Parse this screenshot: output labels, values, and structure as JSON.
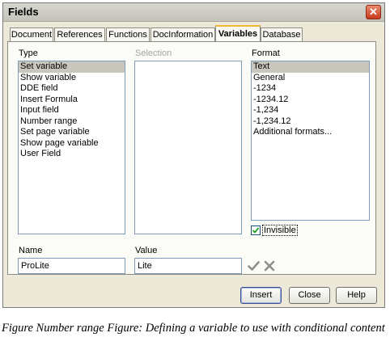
{
  "window": {
    "title": "Fields",
    "close_glyph": "✕"
  },
  "tabs": [
    {
      "label": "Document",
      "active": false
    },
    {
      "label": "References",
      "active": false
    },
    {
      "label": "Functions",
      "active": false
    },
    {
      "label": "DocInformation",
      "active": false
    },
    {
      "label": "Variables",
      "active": true
    },
    {
      "label": "Database",
      "active": false
    }
  ],
  "type": {
    "label": "Type",
    "items": [
      "Set variable",
      "Show variable",
      "DDE field",
      "Insert Formula",
      "Input field",
      "Number range",
      "Set page variable",
      "Show page variable",
      "User Field"
    ],
    "selected": "Set variable"
  },
  "selection": {
    "label": "Selection",
    "items": []
  },
  "format": {
    "label": "Format",
    "items": [
      "Text",
      "General",
      "-1234",
      "-1234.12",
      "-1,234",
      "-1,234.12",
      "Additional formats..."
    ],
    "selected": "Text"
  },
  "invisible": {
    "label": "Invisible",
    "checked": true
  },
  "name": {
    "label": "Name",
    "value": "ProLite"
  },
  "value": {
    "label": "Value",
    "value": "Lite"
  },
  "icons": {
    "apply": "check-icon",
    "delete": "cross-icon"
  },
  "buttons": {
    "insert": "Insert",
    "close": "Close",
    "help": "Help"
  },
  "caption": "Figure Number range Figure: Defining a variable to use with conditional content",
  "colors": {
    "active_tab_accent": "#f2b632",
    "close_button": "#c6391b",
    "selection_bg": "#c9c7bd"
  }
}
